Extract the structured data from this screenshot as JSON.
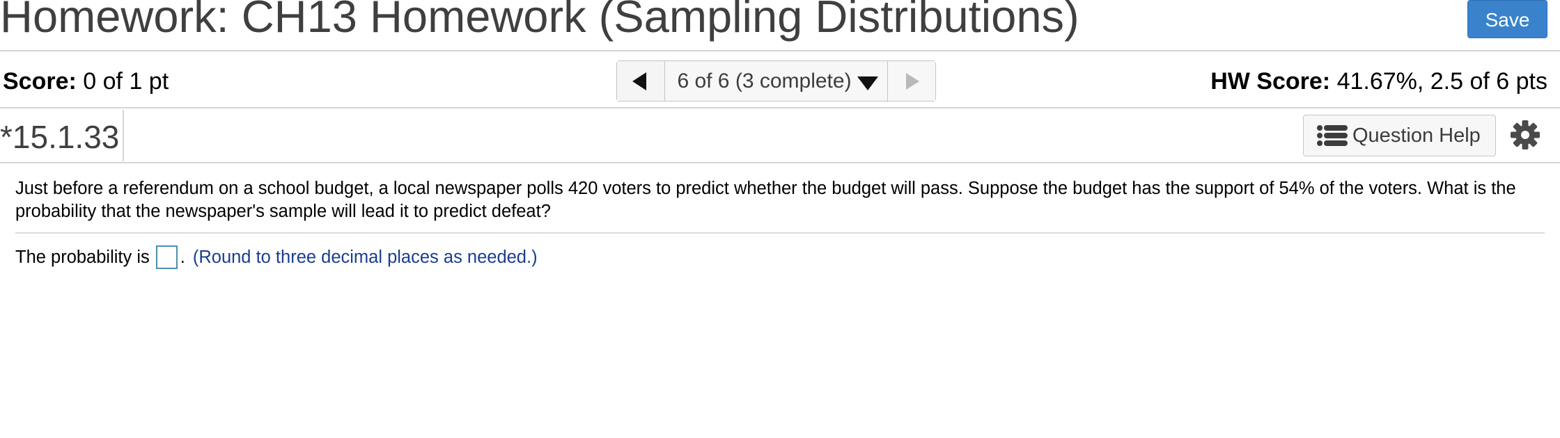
{
  "header": {
    "title": "Homework: CH13 Homework (Sampling Distributions)",
    "save_label": "Save"
  },
  "score_bar": {
    "score_label": "Score:",
    "score_value": "0 of 1 pt",
    "nav_status": "6 of 6 (3 complete)",
    "hw_score_label": "HW Score:",
    "hw_score_value": "41.67%, 2.5 of 6 pts"
  },
  "question_bar": {
    "number": "*15.1.33",
    "help_label": "Question Help",
    "icons": {
      "help": "list-icon",
      "settings": "gear-icon"
    }
  },
  "question": {
    "text": "Just before a referendum on a school budget, a local newspaper polls 420 voters to predict whether the budget will pass. Suppose the budget has the support of 54% of the voters. What is the probability that the newspaper's sample will lead it to predict defeat?",
    "answer_prefix": "The probability is",
    "answer_value": "",
    "answer_suffix": ".",
    "round_note": "(Round to three decimal places as needed.)"
  },
  "colors": {
    "save_button": "#3a83cc",
    "answer_box_border": "#4a8fb0",
    "note_text": "#1a3d8f"
  }
}
